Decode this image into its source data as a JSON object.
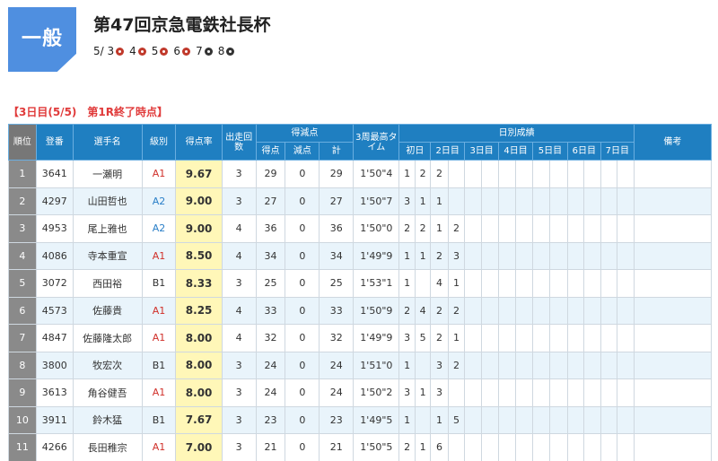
{
  "badge": "一般",
  "race_title": "第47回京急電鉄社長杯",
  "days": [
    {
      "label": "5/ 3",
      "icon": "red-dot-icon",
      "color": "#c0392b"
    },
    {
      "label": "4",
      "icon": "red-dot-icon",
      "color": "#c0392b"
    },
    {
      "label": "5",
      "icon": "red-dot-icon",
      "color": "#c0392b"
    },
    {
      "label": "6",
      "icon": "red-dot-icon",
      "color": "#c0392b"
    },
    {
      "label": "7",
      "icon": "black-dot-icon",
      "color": "#333333"
    },
    {
      "label": "8",
      "icon": "black-dot-icon",
      "color": "#333333"
    }
  ],
  "section": {
    "day_label": "【3日目(5/5)",
    "status_label": "第1R終了時点】"
  },
  "headers": {
    "rank": "順位",
    "reg_no": "登番",
    "name": "選手名",
    "grade": "級別",
    "rate": "得点率",
    "starts": "出走回数",
    "points_group": "得減点",
    "points": "得点",
    "deduct": "減点",
    "total": "計",
    "best_lap": "3周最高タイム",
    "daily_group": "日別成績",
    "daily": [
      "初日",
      "2日目",
      "3日目",
      "4日目",
      "5日目",
      "6日目",
      "7日目"
    ],
    "remarks": "備考"
  },
  "rows": [
    {
      "rank": "1",
      "reg": "3641",
      "name": "一瀬明",
      "grade": "A1",
      "rate": "9.67",
      "starts": "3",
      "points": "29",
      "deduct": "0",
      "total": "29",
      "lap": "1'50\"4",
      "results": [
        "1",
        "2",
        "2",
        "",
        "",
        "",
        "",
        "",
        "",
        "",
        "",
        "",
        "",
        ""
      ]
    },
    {
      "rank": "2",
      "reg": "4297",
      "name": "山田哲也",
      "grade": "A2",
      "rate": "9.00",
      "starts": "3",
      "points": "27",
      "deduct": "0",
      "total": "27",
      "lap": "1'50\"7",
      "results": [
        "3",
        "1",
        "1",
        "",
        "",
        "",
        "",
        "",
        "",
        "",
        "",
        "",
        "",
        ""
      ]
    },
    {
      "rank": "3",
      "reg": "4953",
      "name": "尾上雅也",
      "grade": "A2",
      "rate": "9.00",
      "starts": "4",
      "points": "36",
      "deduct": "0",
      "total": "36",
      "lap": "1'50\"0",
      "results": [
        "2",
        "2",
        "1",
        "2",
        "",
        "",
        "",
        "",
        "",
        "",
        "",
        "",
        "",
        ""
      ]
    },
    {
      "rank": "4",
      "reg": "4086",
      "name": "寺本重宣",
      "grade": "A1",
      "rate": "8.50",
      "starts": "4",
      "points": "34",
      "deduct": "0",
      "total": "34",
      "lap": "1'49\"9",
      "results": [
        "1",
        "1",
        "2",
        "3",
        "",
        "",
        "",
        "",
        "",
        "",
        "",
        "",
        "",
        ""
      ]
    },
    {
      "rank": "5",
      "reg": "3072",
      "name": "西田裕",
      "grade": "B1",
      "rate": "8.33",
      "starts": "3",
      "points": "25",
      "deduct": "0",
      "total": "25",
      "lap": "1'53\"1",
      "results": [
        "1",
        "",
        "4",
        "1",
        "",
        "",
        "",
        "",
        "",
        "",
        "",
        "",
        "",
        ""
      ]
    },
    {
      "rank": "6",
      "reg": "4573",
      "name": "佐藤貴",
      "grade": "A1",
      "rate": "8.25",
      "starts": "4",
      "points": "33",
      "deduct": "0",
      "total": "33",
      "lap": "1'50\"9",
      "results": [
        "2",
        "4",
        "2",
        "2",
        "",
        "",
        "",
        "",
        "",
        "",
        "",
        "",
        "",
        ""
      ]
    },
    {
      "rank": "7",
      "reg": "4847",
      "name": "佐藤隆太郎",
      "grade": "A1",
      "rate": "8.00",
      "starts": "4",
      "points": "32",
      "deduct": "0",
      "total": "32",
      "lap": "1'49\"9",
      "results": [
        "3",
        "5",
        "2",
        "1",
        "",
        "",
        "",
        "",
        "",
        "",
        "",
        "",
        "",
        ""
      ]
    },
    {
      "rank": "8",
      "reg": "3800",
      "name": "牧宏次",
      "grade": "B1",
      "rate": "8.00",
      "starts": "3",
      "points": "24",
      "deduct": "0",
      "total": "24",
      "lap": "1'51\"0",
      "results": [
        "1",
        "",
        "3",
        "2",
        "",
        "",
        "",
        "",
        "",
        "",
        "",
        "",
        "",
        ""
      ]
    },
    {
      "rank": "9",
      "reg": "3613",
      "name": "角谷健吾",
      "grade": "A1",
      "rate": "8.00",
      "starts": "3",
      "points": "24",
      "deduct": "0",
      "total": "24",
      "lap": "1'50\"2",
      "results": [
        "3",
        "1",
        "3",
        "",
        "",
        "",
        "",
        "",
        "",
        "",
        "",
        "",
        "",
        ""
      ]
    },
    {
      "rank": "10",
      "reg": "3911",
      "name": "鈴木猛",
      "grade": "B1",
      "rate": "7.67",
      "starts": "3",
      "points": "23",
      "deduct": "0",
      "total": "23",
      "lap": "1'49\"5",
      "results": [
        "1",
        "",
        "1",
        "5",
        "",
        "",
        "",
        "",
        "",
        "",
        "",
        "",
        "",
        ""
      ]
    },
    {
      "rank": "11",
      "reg": "4266",
      "name": "長田稚宗",
      "grade": "A1",
      "rate": "7.00",
      "starts": "3",
      "points": "21",
      "deduct": "0",
      "total": "21",
      "lap": "1'50\"5",
      "results": [
        "2",
        "1",
        "6",
        "",
        "",
        "",
        "",
        "",
        "",
        "",
        "",
        "",
        "",
        ""
      ]
    }
  ]
}
